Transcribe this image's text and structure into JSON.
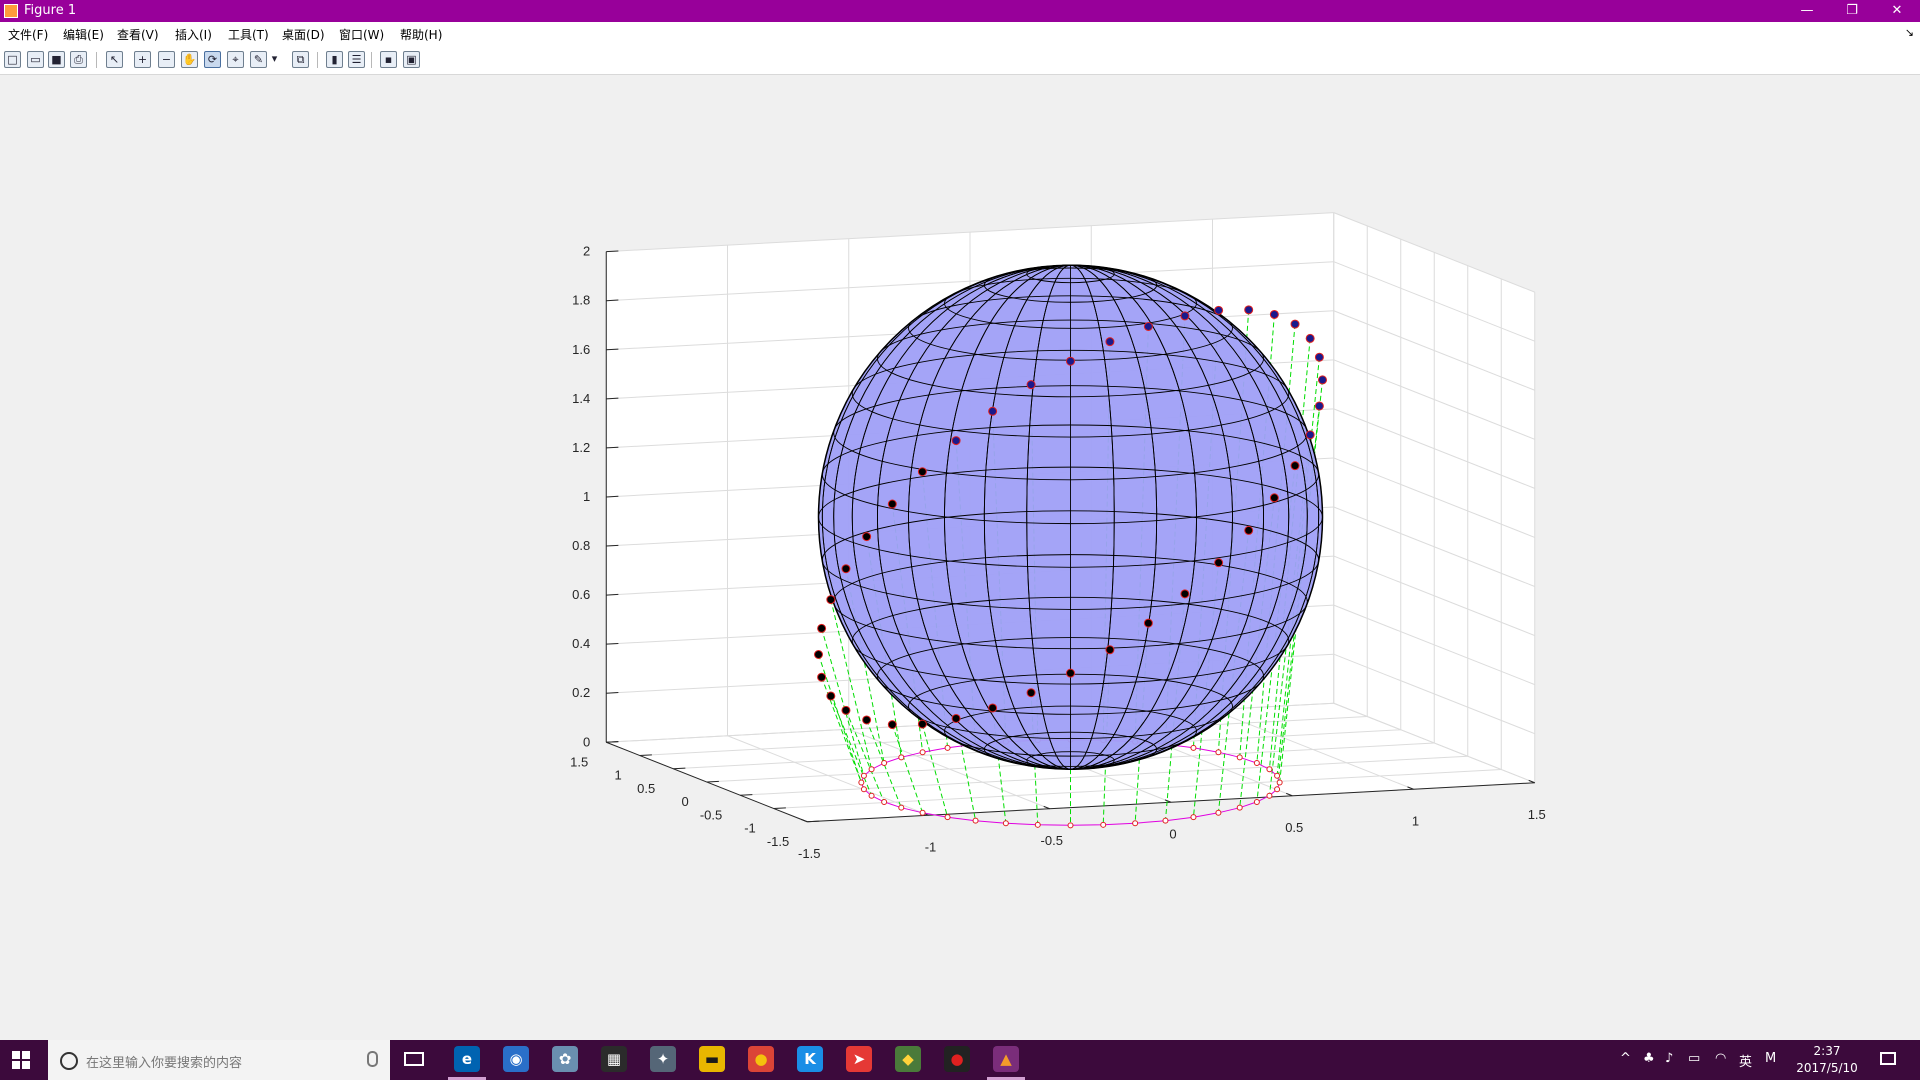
{
  "window": {
    "title": "Figure 1",
    "minimize": "—",
    "restore": "❐",
    "close": "✕"
  },
  "menu": [
    "文件(F)",
    "编辑(E)",
    "查看(V)",
    "插入(I)",
    "工具(T)",
    "桌面(D)",
    "窗口(W)",
    "帮助(H)"
  ],
  "menu_dock_glyph": "↘",
  "toolbar": [
    {
      "name": "new-figure-icon",
      "glyph": "□"
    },
    {
      "name": "open-file-icon",
      "glyph": "▭"
    },
    {
      "name": "save-icon",
      "glyph": "■"
    },
    {
      "name": "print-icon",
      "glyph": "⎙"
    },
    {
      "name": "edit-plot-arrow-icon",
      "glyph": "↖"
    },
    {
      "name": "zoom-in-icon",
      "glyph": "+"
    },
    {
      "name": "zoom-out-icon",
      "glyph": "−"
    },
    {
      "name": "pan-hand-icon",
      "glyph": "✋"
    },
    {
      "name": "rotate-3d-icon",
      "glyph": "⟳",
      "active": true
    },
    {
      "name": "data-cursor-icon",
      "glyph": "⌖"
    },
    {
      "name": "brush-icon",
      "glyph": "✎"
    },
    {
      "name": "brush-dropdown-icon",
      "glyph": "▾"
    },
    {
      "name": "link-plot-icon",
      "glyph": "⧉"
    },
    {
      "name": "colorbar-icon",
      "glyph": "▮"
    },
    {
      "name": "legend-icon",
      "glyph": "☰"
    },
    {
      "name": "hide-plot-tools-icon",
      "glyph": "▪"
    },
    {
      "name": "show-plot-tools-icon",
      "glyph": "▣"
    }
  ],
  "chart_data": {
    "type": "scatter",
    "subtype": "3d-surface-with-scatter",
    "title": "",
    "xlabel": "",
    "ylabel": "",
    "zlabel": "",
    "xlim": [
      -1.5,
      1.5
    ],
    "ylim": [
      -1.5,
      1.5
    ],
    "zlim": [
      0,
      2
    ],
    "x_ticks": [
      "-1.5",
      "-1",
      "-0.5",
      "0",
      "0.5",
      "1",
      "1.5"
    ],
    "y_ticks": [
      "-1.5",
      "-1",
      "-0.5",
      "0",
      "0.5",
      "1",
      "1.5"
    ],
    "z_ticks": [
      "0",
      "0.2",
      "0.4",
      "0.6",
      "0.8",
      "1",
      "1.2",
      "1.4",
      "1.6",
      "1.8",
      "2"
    ],
    "grid": true,
    "legend": "none",
    "view": {
      "azimuth_deg": -25,
      "elevation_deg": 12
    },
    "surface": {
      "shape": "sphere",
      "center": [
        0,
        0,
        1
      ],
      "radius": 1,
      "mesh_divisions": 36,
      "face_color": "#9f9ff7",
      "edge_color": "#000000"
    },
    "points": {
      "curve": "circle of radius 1 in the plane z = 1 + 0.9·x, lying on the sphere",
      "count": 40,
      "marker_fill": "#000000",
      "marker_edge": "#e02020",
      "marker_fill_upper": "#1a1a8c"
    },
    "projection_ring": {
      "z": 0,
      "radius": 1,
      "line_color": "#e000e0",
      "marker_edge": "#e02020"
    },
    "drop_lines": {
      "color": "#00dd00",
      "style": "dashed"
    }
  },
  "taskbar": {
    "search_placeholder": "在这里输入你要搜索的内容",
    "apps": [
      {
        "name": "edge-icon",
        "glyph": "e",
        "bg": "#0063b1",
        "color": "#ffffff",
        "running": true
      },
      {
        "name": "browser-globe-icon",
        "glyph": "◉",
        "bg": "#2a6fc9",
        "color": "#ffffff",
        "running": false
      },
      {
        "name": "paint-icon",
        "glyph": "✿",
        "bg": "#6a8fb0",
        "color": "#ffffff",
        "running": false
      },
      {
        "name": "calculator-icon",
        "glyph": "▦",
        "bg": "#2b2b2b",
        "color": "#ffffff",
        "running": false
      },
      {
        "name": "satellite-app-icon",
        "glyph": "✦",
        "bg": "#556677",
        "color": "#ffffff",
        "running": false
      },
      {
        "name": "file-explorer-icon",
        "glyph": "▬",
        "bg": "#e8b600",
        "color": "#1a1a1a",
        "running": false
      },
      {
        "name": "chrome-icon",
        "glyph": "●",
        "bg": "#db4437",
        "color": "#f4c20d",
        "running": false
      },
      {
        "name": "kugou-icon",
        "glyph": "K",
        "bg": "#1a8ee6",
        "color": "#ffffff",
        "running": false
      },
      {
        "name": "compass-app-icon",
        "glyph": "➤",
        "bg": "#e53935",
        "color": "#ffffff",
        "running": false
      },
      {
        "name": "git-app-icon",
        "glyph": "◆",
        "bg": "#4a7a3a",
        "color": "#ffd23a",
        "running": false
      },
      {
        "name": "record-app-icon",
        "glyph": "●",
        "bg": "#222222",
        "color": "#e02020",
        "running": false
      },
      {
        "name": "matlab-icon",
        "glyph": "▲",
        "bg": "#7a2d7a",
        "color": "#f39b2a",
        "running": true
      }
    ],
    "tray": {
      "chevron": "^",
      "ime": "英",
      "ime_mode": "M"
    },
    "time": "2:37",
    "date": "2017/5/10"
  }
}
